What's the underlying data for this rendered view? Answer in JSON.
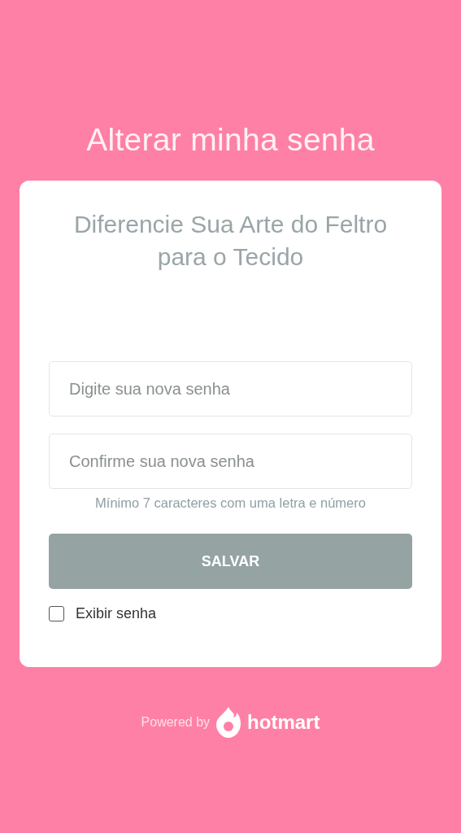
{
  "title": "Alterar minha senha",
  "card": {
    "subtitle": "Diferencie Sua Arte do Feltro para o Tecido",
    "fields": [
      {
        "placeholder": "Digite sua nova senha"
      },
      {
        "placeholder": "Confirme sua nova senha"
      }
    ],
    "hint": "Mínimo 7 caracteres com uma letra e número",
    "button": {
      "label": "SALVAR",
      "disabled": true
    },
    "show_password": {
      "label": "Exibir senha",
      "checked": false
    }
  },
  "footer": {
    "powered_by": "Powered by",
    "brand": "hotmart"
  }
}
